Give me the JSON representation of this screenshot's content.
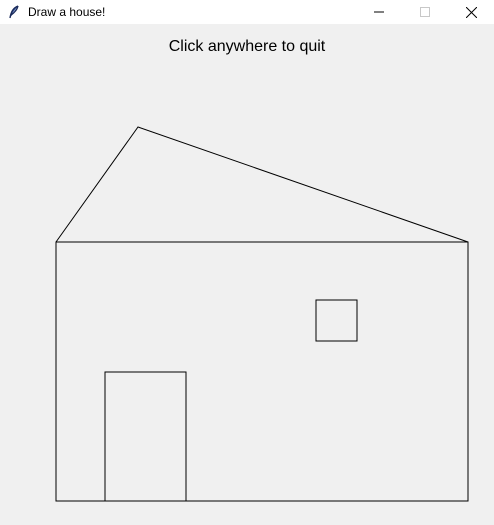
{
  "window": {
    "title": "Draw a house!",
    "icon": "feather-icon",
    "controls": [
      "minimize-icon",
      "maximize-icon",
      "close-icon"
    ]
  },
  "canvas": {
    "message": "Click anywhere to quit"
  }
}
